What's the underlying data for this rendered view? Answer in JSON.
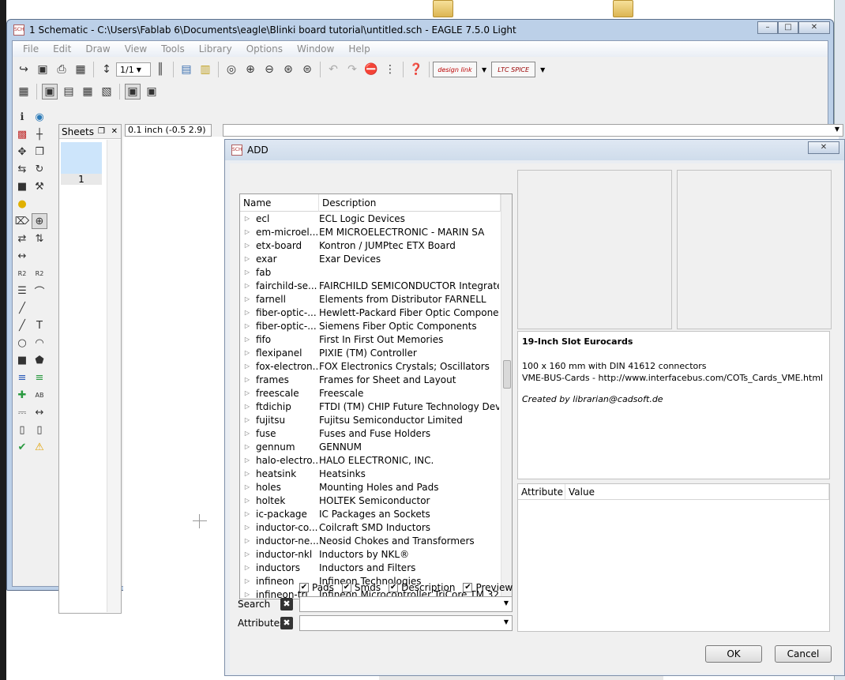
{
  "window": {
    "title": "1 Schematic - C:\\Users\\Fablab 6\\Documents\\eagle\\Blinki board tutorial\\untitled.sch - EAGLE 7.5.0 Light",
    "icon_text": "SCH",
    "buttons": {
      "minimize": "–",
      "maximize": "□",
      "close": "✕"
    }
  },
  "menu": [
    "File",
    "Edit",
    "Draw",
    "View",
    "Tools",
    "Library",
    "Options",
    "Window",
    "Help"
  ],
  "toolbar": {
    "sheet_select": "1/1",
    "design_link": "design link",
    "ltc_spice": "LTC SPICE"
  },
  "sheets": {
    "header": "Sheets",
    "sheet_number": "1"
  },
  "status": {
    "coordinate": "0.1 inch (-0.5 2.9)",
    "command": ""
  },
  "dialog": {
    "title": "ADD",
    "icon_text": "SCH",
    "list_headers": {
      "name": "Name",
      "description": "Description"
    },
    "rows": [
      {
        "name": "ecl",
        "desc": "ECL Logic Devices"
      },
      {
        "name": "em-microel...",
        "desc": "EM MICROELECTRONIC - MARIN SA"
      },
      {
        "name": "etx-board",
        "desc": "Kontron / JUMPtec ETX Board"
      },
      {
        "name": "exar",
        "desc": "Exar Devices"
      },
      {
        "name": "fab",
        "desc": ""
      },
      {
        "name": "fairchild-se...",
        "desc": "FAIRCHILD SEMICONDUCTOR Integrate..."
      },
      {
        "name": "farnell",
        "desc": "Elements from Distributor FARNELL"
      },
      {
        "name": "fiber-optic-...",
        "desc": "Hewlett-Packard Fiber Optic Components"
      },
      {
        "name": "fiber-optic-...",
        "desc": "Siemens Fiber Optic Components"
      },
      {
        "name": "fifo",
        "desc": "First In First Out Memories"
      },
      {
        "name": "flexipanel",
        "desc": "PIXIE (TM) Controller"
      },
      {
        "name": "fox-electron...",
        "desc": "FOX Electronics Crystals; Oscillators"
      },
      {
        "name": "frames",
        "desc": "Frames for Sheet and Layout"
      },
      {
        "name": "freescale",
        "desc": "Freescale"
      },
      {
        "name": "ftdichip",
        "desc": "FTDI (TM) CHIP Future Technology Devi..."
      },
      {
        "name": "fujitsu",
        "desc": "Fujitsu Semiconductor Limited"
      },
      {
        "name": "fuse",
        "desc": "Fuses and Fuse Holders"
      },
      {
        "name": "gennum",
        "desc": "GENNUM"
      },
      {
        "name": "halo-electro...",
        "desc": "HALO ELECTRONIC, INC."
      },
      {
        "name": "heatsink",
        "desc": "Heatsinks"
      },
      {
        "name": "holes",
        "desc": "Mounting Holes and Pads"
      },
      {
        "name": "holtek",
        "desc": "HOLTEK Semiconductor"
      },
      {
        "name": "ic-package",
        "desc": "IC Packages an Sockets"
      },
      {
        "name": "inductor-co...",
        "desc": "Coilcraft SMD Inductors"
      },
      {
        "name": "inductor-ne...",
        "desc": "Neosid Chokes and Transformers"
      },
      {
        "name": "inductor-nkl",
        "desc": "Inductors by NKL®"
      },
      {
        "name": "inductors",
        "desc": "Inductors and Filters"
      },
      {
        "name": "infineon",
        "desc": "Infineon Technologies"
      },
      {
        "name": "infineon-tri...",
        "desc": "Infineon Microcontroller TriCore TM 32-..."
      }
    ],
    "description": {
      "title": "19-Inch Slot Eurocards",
      "line1": "100 x 160 mm with DIN 41612 connectors",
      "line2": "VME-BUS-Cards - http://www.interfacebus.com/COTs_Cards_VME.html",
      "credit": "Created by librarian@cadsoft.de"
    },
    "attr_headers": {
      "attribute": "Attribute",
      "value": "Value"
    },
    "checkboxes": [
      {
        "label": "Pads",
        "checked": true
      },
      {
        "label": "Smds",
        "checked": true
      },
      {
        "label": "Description",
        "checked": true
      },
      {
        "label": "Preview",
        "checked": true
      }
    ],
    "search_label": "Search",
    "attributes_label": "Attributes",
    "ok": "OK",
    "cancel": "Cancel"
  }
}
